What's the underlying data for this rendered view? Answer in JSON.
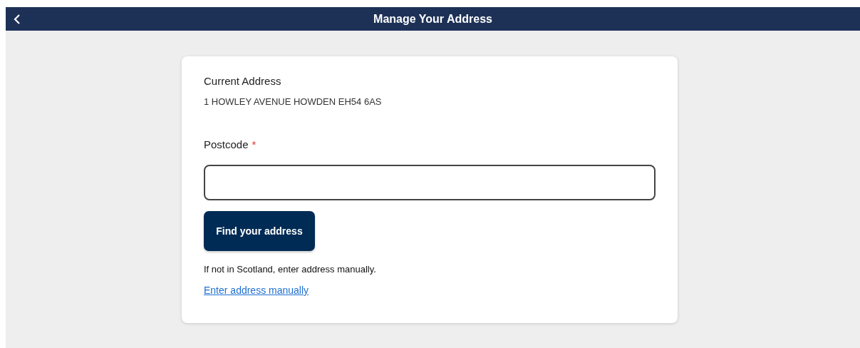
{
  "header": {
    "title": "Manage Your Address"
  },
  "current_address": {
    "label": "Current Address",
    "value": "1 HOWLEY AVENUE HOWDEN EH54 6AS"
  },
  "postcode": {
    "label": "Postcode",
    "required_mark": "*"
  },
  "find_button": {
    "label": "Find your address"
  },
  "note": "If not in Scotland, enter address manually.",
  "manual_link": {
    "label": "Enter address manually"
  }
}
